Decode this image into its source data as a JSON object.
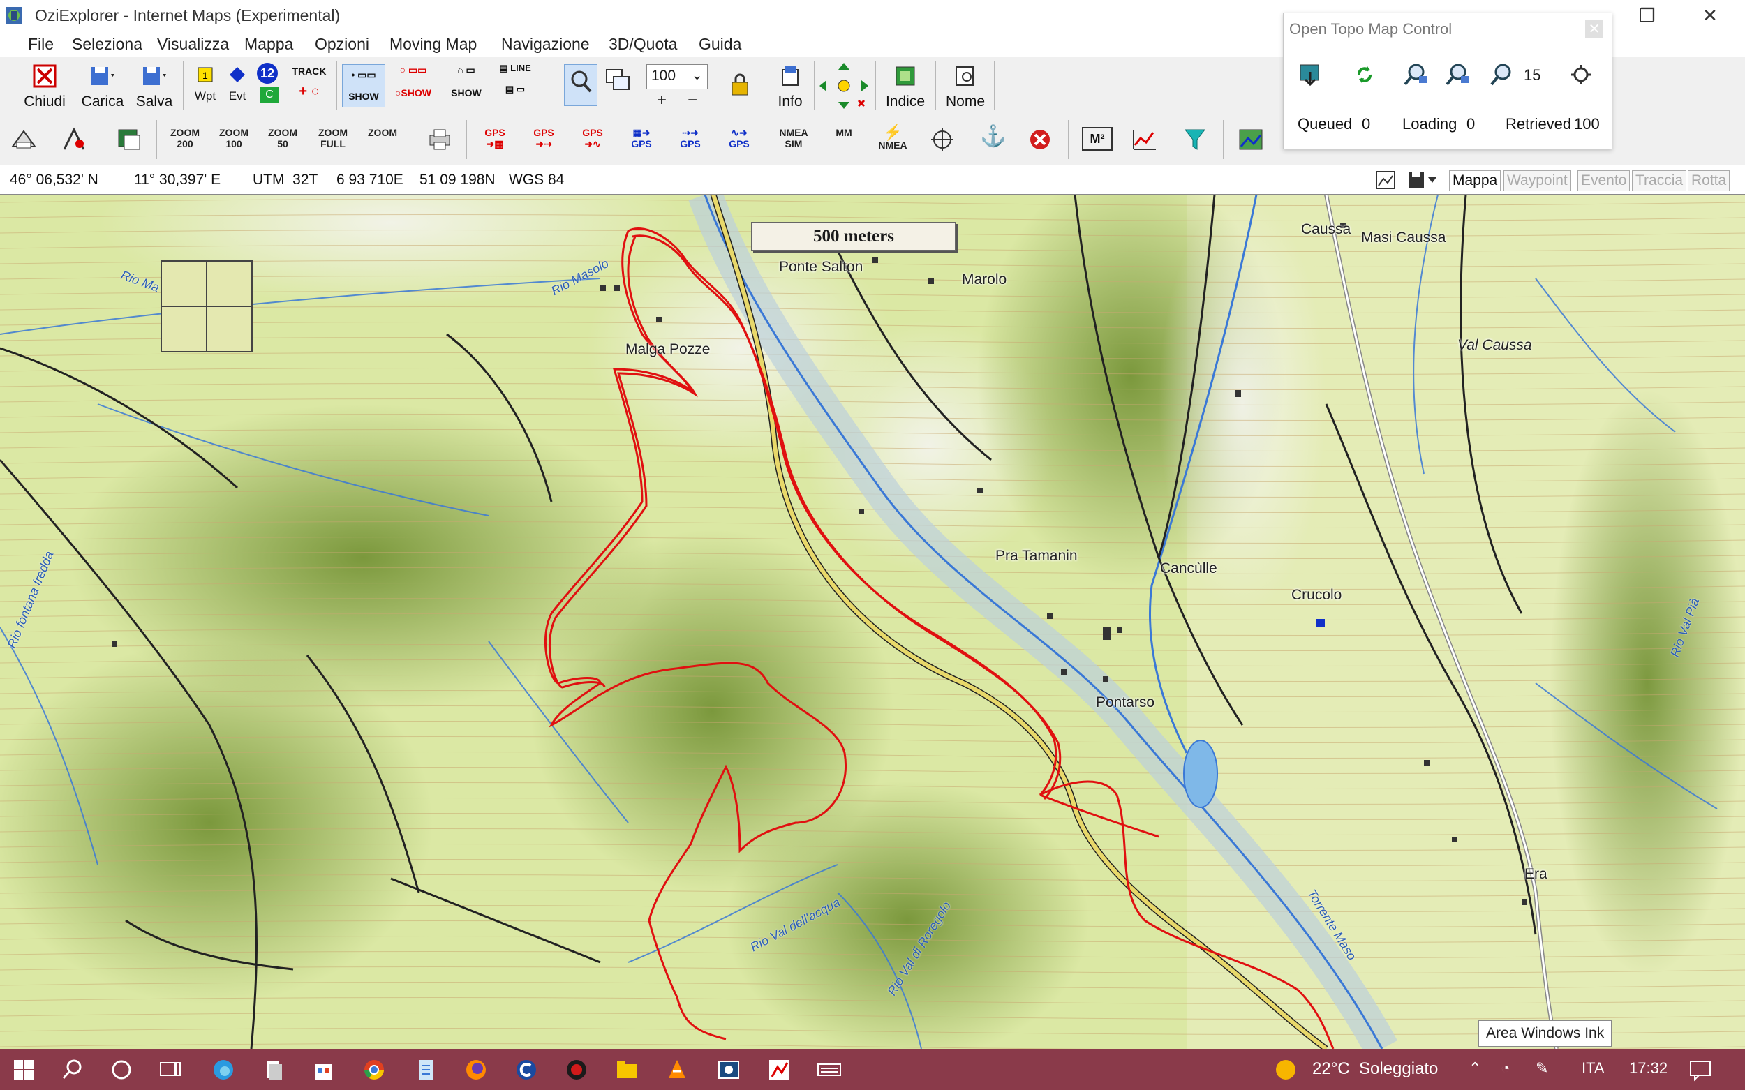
{
  "window": {
    "title": "OziExplorer - Internet Maps (Experimental)"
  },
  "menu": [
    "File",
    "Seleziona",
    "Visualizza",
    "Mappa",
    "Opzioni",
    "Moving Map",
    "Navigazione",
    "3D/Quota",
    "Guida"
  ],
  "toolbar1": {
    "chiudi": "Chiudi",
    "carica": "Carica",
    "salva": "Salva",
    "wpt": "Wpt",
    "evt": "Evt",
    "track": "TRACK",
    "show": "SHOW",
    "badge": "12",
    "c": "C",
    "zoom_value": "100",
    "info": "Info",
    "indice": "Indice",
    "nome": "Nome",
    "line": "LINE"
  },
  "toolbar2": {
    "zoom200": "ZOOM 200",
    "zoom100": "ZOOM 100",
    "zoom50": "ZOOM 50",
    "zoomfull": "ZOOM FULL",
    "zoom": "ZOOM",
    "nmea_sim": "NMEA SIM",
    "mm": "MM",
    "nmea": "NMEA",
    "m2": "M²",
    "gps": "GPS"
  },
  "status": {
    "lat": "46° 06,532' N",
    "lon": "11° 30,397' E",
    "utm": "UTM  32T",
    "east": "6 93 710E",
    "north": "51 09 198N",
    "datum": "WGS 84",
    "tabs": [
      "Mappa",
      "Waypoint",
      "Evento",
      "Traccia",
      "Rotta"
    ],
    "active_tab": "Mappa"
  },
  "topo": {
    "title": "Open Topo Map Control",
    "zoom": "15",
    "queued_label": "Queued",
    "queued": "0",
    "loading_label": "Loading",
    "loading": "0",
    "retrieved_label": "Retrieved",
    "retrieved": "100"
  },
  "map": {
    "scale": "500 meters",
    "places": [
      "Ponte Salton",
      "Marolo",
      "Malga Pozze",
      "Caussa",
      "Masi Caussa",
      "Val Caussa",
      "Pra Tamanin",
      "Cancùlle",
      "Crucolo",
      "Pontarso",
      "Era"
    ],
    "rivers": [
      "Rio Masolo",
      "Rio Ma",
      "Rio fontana fredda",
      "Rio Val dell'acqua",
      "Rio Val di Roregolo",
      "Torrente Maso",
      "Rio Val Pià"
    ],
    "colors": {
      "track": "#e01010",
      "road": "#e8d86a",
      "water": "#3a78d6"
    }
  },
  "taskbar": {
    "weather": "22°C  Soleggiato",
    "lang": "ITA",
    "time": "17:32",
    "tooltip": "Area Windows Ink",
    "accent": "#8a3a4a"
  }
}
